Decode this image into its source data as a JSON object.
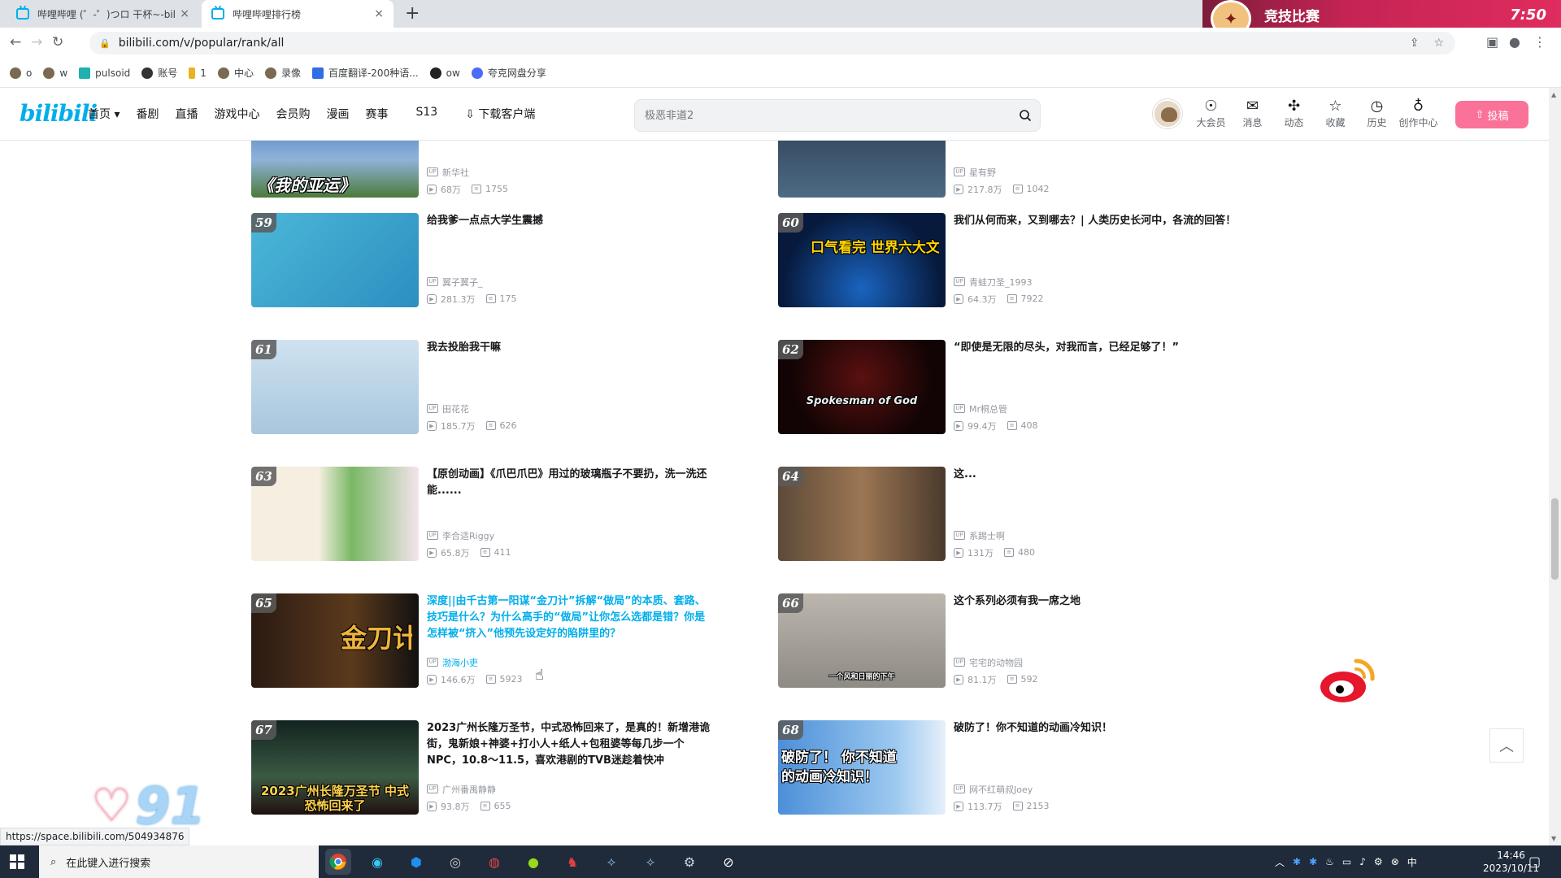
{
  "browser": {
    "tabs": [
      {
        "title": "哔哩哔哩 (゜-゜)つロ 干杯~-bili",
        "active": false
      },
      {
        "title": "哔哩哔哩排行榜",
        "active": true
      }
    ],
    "new_tab": "+",
    "close_glyph": "×",
    "url": "bilibili.com/v/popular/rank/all",
    "promo_banner": {
      "label": "竞技比赛",
      "time": "7:50"
    },
    "bookmarks": [
      "o",
      "w",
      "pulsoid",
      "账号",
      "1",
      "中心",
      "录像",
      "百度翻译-200种语...",
      "ow",
      "夸克网盘分享"
    ]
  },
  "header": {
    "logo": "bilibili",
    "nav": [
      "首页 ▾",
      "番剧",
      "直播",
      "游戏中心",
      "会员购",
      "漫画",
      "赛事",
      "S13",
      "下载客户端"
    ],
    "search_placeholder": "极恶非道2",
    "right_nav": [
      {
        "label": "大会员",
        "icon": "vip-icon",
        "glyph": "☉"
      },
      {
        "label": "消息",
        "icon": "message-icon",
        "glyph": "✉"
      },
      {
        "label": "动态",
        "icon": "dynamic-icon",
        "glyph": "✣"
      },
      {
        "label": "收藏",
        "icon": "favorite-icon",
        "glyph": "☆"
      },
      {
        "label": "历史",
        "icon": "history-icon",
        "glyph": "◷"
      },
      {
        "label": "创作中心",
        "icon": "creator-icon",
        "glyph": "♁"
      }
    ],
    "upload_label": "投稿"
  },
  "rank_list": [
    {
      "rank": "",
      "title": "",
      "author": "新华社",
      "plays": "68万",
      "danmaku": "1755",
      "thumb_caption": "《我的亚运》",
      "highlight": false
    },
    {
      "rank": "",
      "title": "",
      "author": "星有野",
      "plays": "217.8万",
      "danmaku": "1042",
      "thumb_caption": "",
      "highlight": false
    },
    {
      "rank": "59",
      "title": "给我爹一点点大学生震撼",
      "author": "翼子翼子_",
      "plays": "281.3万",
      "danmaku": "175",
      "thumb_caption": "",
      "highlight": false
    },
    {
      "rank": "60",
      "title": "我们从何而来，又到哪去？| 人类历史长河中，各流的回答！",
      "author": "青蛙刀圣_1993",
      "plays": "64.3万",
      "danmaku": "7922",
      "thumb_caption": "口气看完 世界六大文化",
      "highlight": false
    },
    {
      "rank": "61",
      "title": "我去投胎我干嘛",
      "author": "田花花",
      "plays": "185.7万",
      "danmaku": "626",
      "thumb_caption": "",
      "highlight": false
    },
    {
      "rank": "62",
      "title": "“即使是无限的尽头，对我而言，已经足够了！”",
      "author": "Mr桐总管",
      "plays": "99.4万",
      "danmaku": "408",
      "thumb_caption": "Spokesman of God",
      "highlight": false
    },
    {
      "rank": "63",
      "title": "【原创动画】《爪巴爪巴》用过的玻璃瓶子不要扔，洗一洗还能......",
      "author": "李合适Riggy",
      "plays": "65.8万",
      "danmaku": "411",
      "thumb_caption": "",
      "highlight": false
    },
    {
      "rank": "64",
      "title": "这...",
      "author": "系踢士啊",
      "plays": "131万",
      "danmaku": "480",
      "thumb_caption": "",
      "highlight": false
    },
    {
      "rank": "65",
      "title": "深度||由千古第一阳谋“金刀计”拆解“做局”的本质、套路、技巧是什么？为什么高手的“做局”让你怎么选都是错？你是怎样被“挤入”他预先设定好的陷阱里的？",
      "author": "渤海小吏",
      "plays": "146.6万",
      "danmaku": "5923",
      "thumb_caption": "金刀计",
      "highlight": true
    },
    {
      "rank": "66",
      "title": "这个系列必须有我一席之地",
      "author": "宅宅的动物园",
      "plays": "81.1万",
      "danmaku": "592",
      "thumb_caption": "一个风和日丽的下午",
      "highlight": false
    },
    {
      "rank": "67",
      "title": "2023广州长隆万圣节，中式恐怖回来了，是真的！新增港诡街，鬼新娘+神婆+打小人+纸人+包租婆等每几步一个NPC，10.8～11.5，喜欢港剧的TVB迷趁着快冲",
      "author": "广州番禺静静",
      "plays": "93.8万",
      "danmaku": "655",
      "thumb_caption": "2023广州长隆万圣节 中式恐怖回来了",
      "highlight": false
    },
    {
      "rank": "68",
      "title": "破防了！你不知道的动画冷知识！",
      "author": "网不红萌叔Joey",
      "plays": "113.7万",
      "danmaku": "2153",
      "thumb_caption": "破防了！ 你不知道的动画冷知识！",
      "highlight": false
    }
  ],
  "overlay": {
    "like_count": "91",
    "hover_link": "https://space.bilibili.com/504934876"
  },
  "taskbar": {
    "search_placeholder": "在此键入进行搜索",
    "time": "14:46",
    "date": "2023/10/11"
  },
  "colors": {
    "brand_blue": "#00aeec",
    "brand_pink": "#fb7299",
    "text": "#18191c",
    "meta": "#9499a0"
  }
}
